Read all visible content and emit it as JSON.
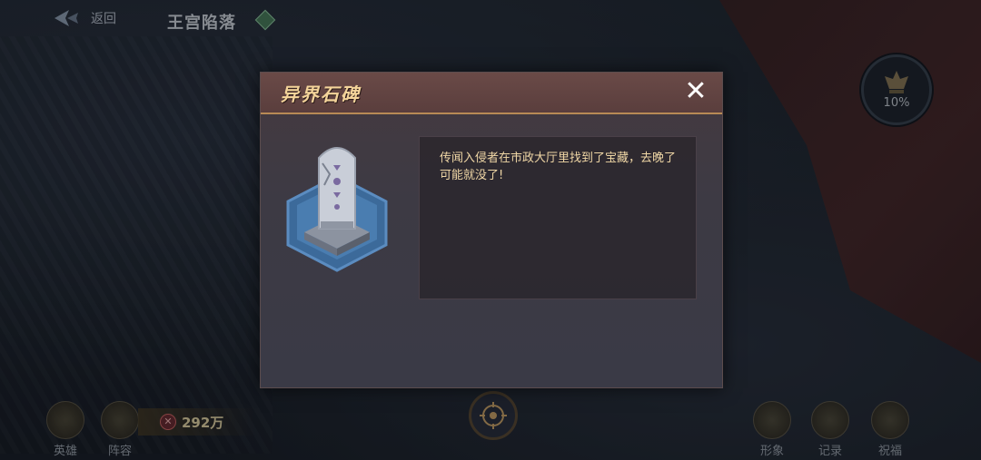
{
  "topbar": {
    "back_label": "返回",
    "stage_title": "王宫陷落"
  },
  "progress": {
    "percent_text": "10%"
  },
  "bottom": {
    "left_buttons": [
      {
        "label": "英雄",
        "icon": "hero-icon"
      },
      {
        "label": "阵容",
        "icon": "formation-icon"
      }
    ],
    "currency": {
      "value": "292万",
      "icon": "currency-icon"
    },
    "right_buttons": [
      {
        "label": "形象",
        "icon": "appearance-icon"
      },
      {
        "label": "记录",
        "icon": "record-icon"
      },
      {
        "label": "祝福",
        "icon": "blessing-icon"
      }
    ]
  },
  "dialog": {
    "title": "异界石碑",
    "close_icon": "close-icon",
    "description": "传闻入侵者在市政大厅里找到了宝藏，去晚了可能就没了!",
    "image_icon": "stone-stele-icon"
  },
  "colors": {
    "title_gold": "#f4d49a",
    "text_gold": "#f0d7a6",
    "header_border": "#b88a55"
  }
}
